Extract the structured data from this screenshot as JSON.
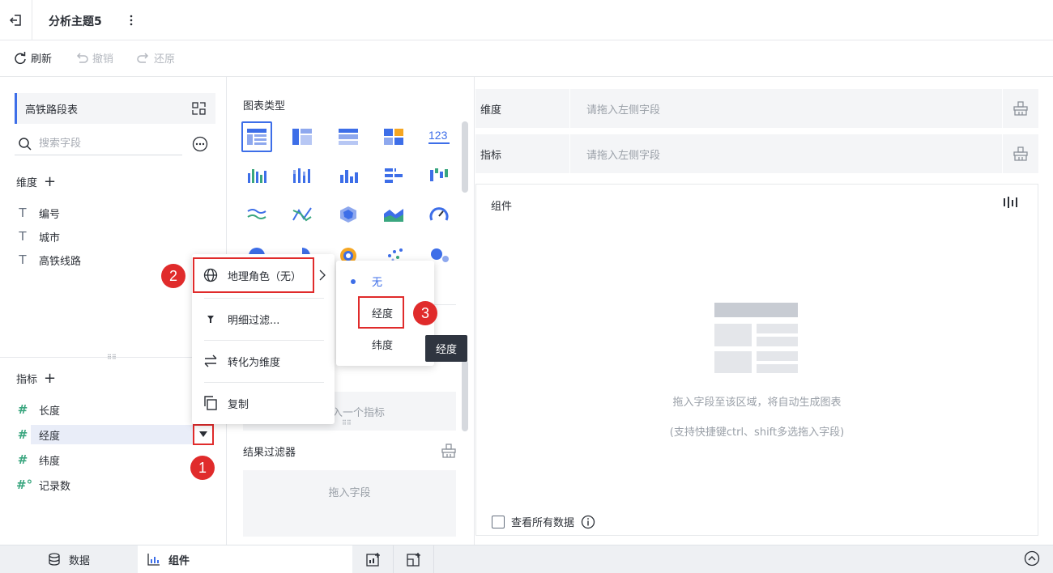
{
  "header": {
    "title": "分析主题5"
  },
  "toolbar": {
    "refresh": "刷新",
    "undo": "撤销",
    "redo": "还原"
  },
  "left": {
    "table_name": "高铁路段表",
    "search_placeholder": "搜索字段",
    "dimensions_title": "维度",
    "dimensions": [
      "编号",
      "城市",
      "高铁线路"
    ],
    "metrics_title": "指标",
    "metrics": [
      "长度",
      "经度",
      "纬度",
      "记录数"
    ]
  },
  "middle": {
    "chart_type_title": "图表类型",
    "metric_drop_hint": "入一个指标",
    "filter_title": "结果过滤器",
    "filter_drop_hint": "拖入字段"
  },
  "right": {
    "dimension_label": "维度",
    "dimension_hint": "请拖入左侧字段",
    "metric_label": "指标",
    "metric_hint": "请拖入左侧字段",
    "component_title": "组件",
    "hint_line1": "拖入字段至该区域，将自动生成图表",
    "hint_line2": "(支持快捷键ctrl、shift多选拖入字段)",
    "view_all": "查看所有数据"
  },
  "context_menu": {
    "geo_role": "地理角色（无）",
    "detail_filter": "明细过滤...",
    "to_dimension": "转化为维度",
    "copy": "复制"
  },
  "submenu": {
    "none": "无",
    "longitude": "经度",
    "latitude": "纬度"
  },
  "tooltip": "经度",
  "badges": [
    "1",
    "2",
    "3"
  ],
  "bottom": {
    "data_tab": "数据",
    "component_tab": "组件"
  },
  "colors": {
    "accent": "#3d6ee8",
    "highlight": "#e02b2b",
    "metric_icon": "#3aa67f"
  }
}
